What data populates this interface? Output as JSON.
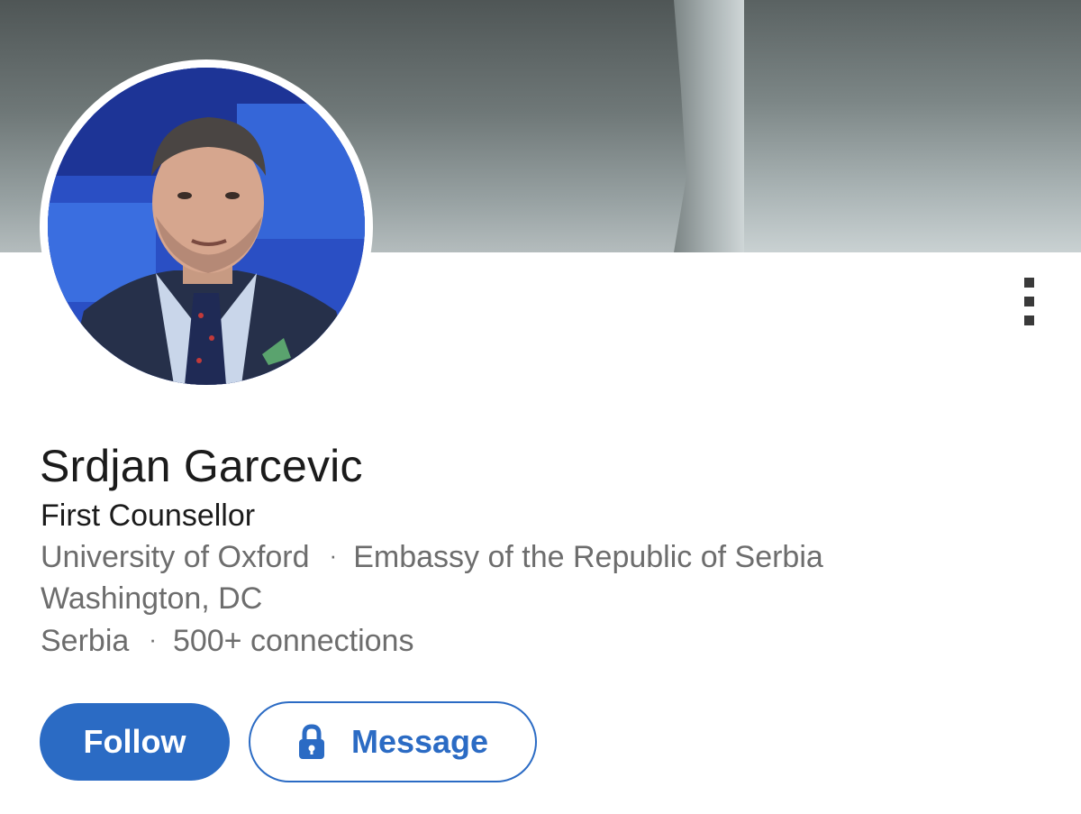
{
  "profile": {
    "name": "Srdjan Garcevic",
    "headline": "First Counsellor",
    "education": "University of Oxford",
    "company": "Embassy of the Republic of Serbia",
    "company_location": "Washington, DC",
    "location": "Serbia",
    "connections": "500+ connections",
    "separator": "·"
  },
  "actions": {
    "follow_label": "Follow",
    "message_label": "Message"
  },
  "icons": {
    "more": "vertical-ellipsis-icon",
    "lock": "lock-icon"
  },
  "colors": {
    "primary": "#2b6bc4",
    "text": "#1b1b1b",
    "muted": "#6d6d6d"
  }
}
